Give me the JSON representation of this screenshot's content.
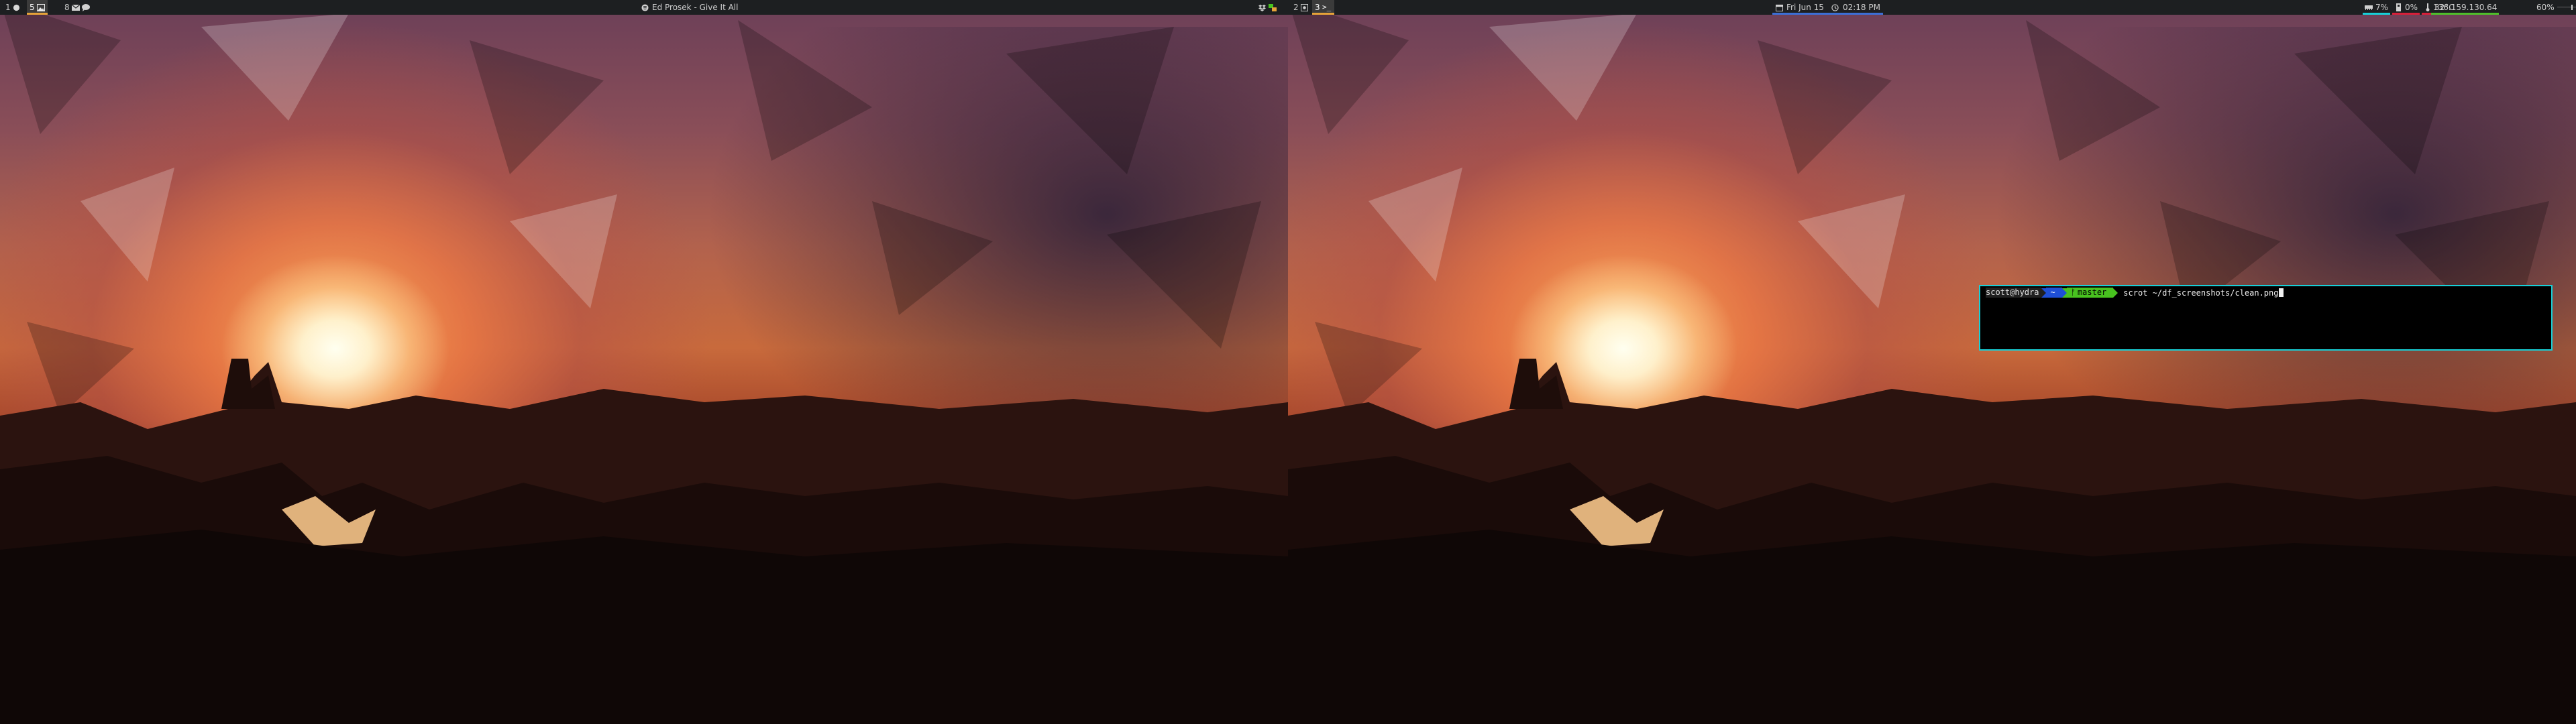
{
  "left_bar": {
    "workspaces": [
      {
        "label": "1",
        "icons": [
          "firefox-icon"
        ],
        "active": false
      },
      {
        "label": "5",
        "icons": [
          "image-viewer-icon"
        ],
        "active": true
      },
      {
        "label": "8",
        "icons": [
          "mail-icon",
          "chat-icon"
        ],
        "active": false
      }
    ],
    "now_playing": "Ed Prosek - Give It All",
    "tray_icons": [
      "dropbox-icon",
      "network-icon"
    ]
  },
  "right_bar": {
    "workspaces": [
      {
        "label": "2",
        "icons": [
          "app-icon"
        ],
        "active": false
      },
      {
        "label": "3",
        "icons": [
          "terminal-icon"
        ],
        "active": true
      }
    ],
    "date": "Fri Jun 15",
    "time": "02:18 PM",
    "memory": "7%",
    "cpu": "0%",
    "temperature": "32°C",
    "ip_address": "136.159.130.64",
    "volume": "60%",
    "volume_level": 0.6
  },
  "terminal": {
    "user_host": "scott@hydra",
    "path": "~",
    "git_branch": "master",
    "command": "scrot ~/df_screenshots/clean.png"
  },
  "colors": {
    "bar_bg": "#1d1f21",
    "active_underline": "#e6a339",
    "date_underline": "#3c6fd6",
    "memory_underline": "#17d0d8",
    "cpu_underline": "#d8203a",
    "temp_underline": "#d8203a",
    "ip_underline": "#4fbf2b",
    "terminal_border": "#17d0d8",
    "prompt_path_bg": "#1e4fd6",
    "prompt_git_bg": "#48c21f"
  }
}
